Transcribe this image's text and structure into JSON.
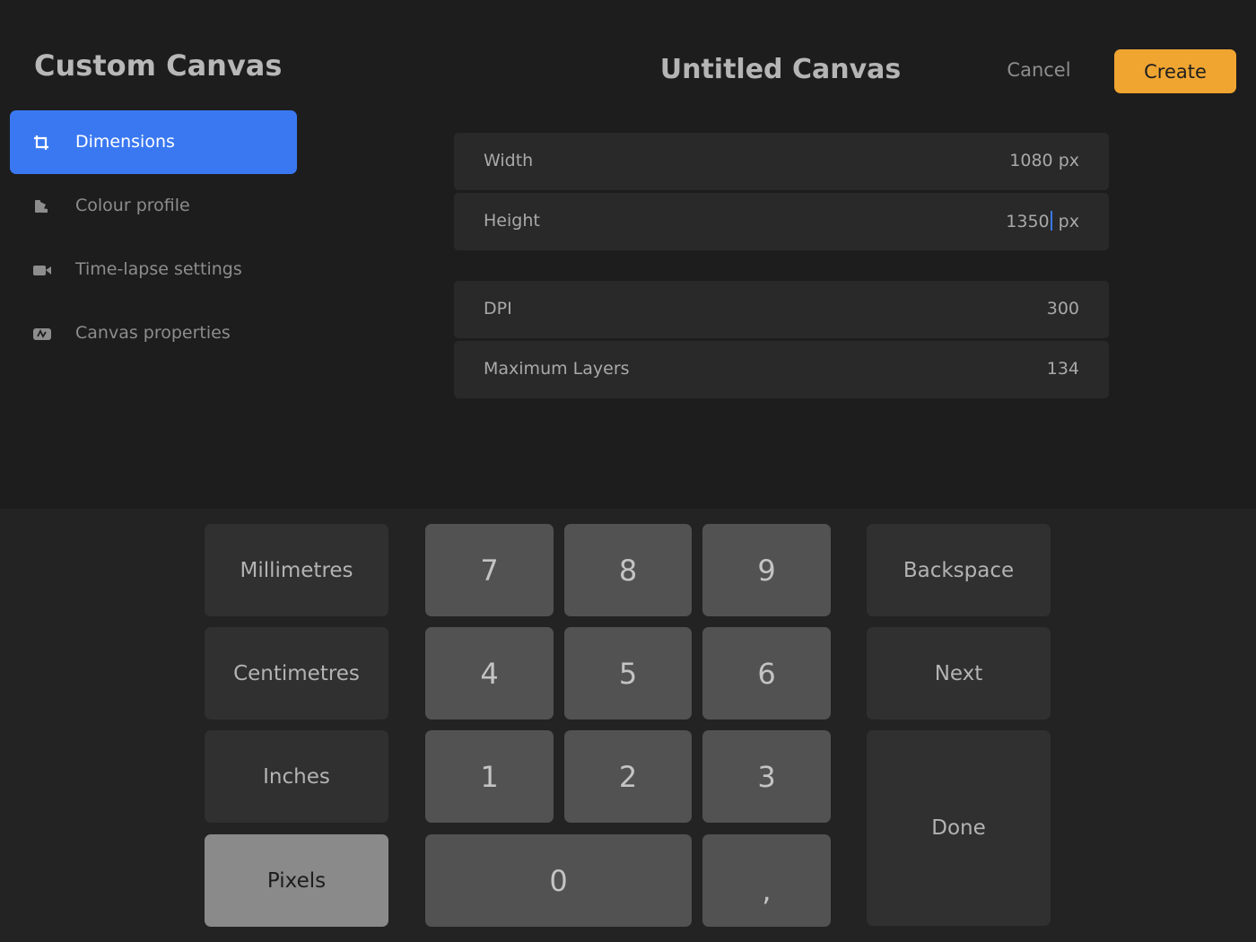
{
  "panel_title": "Custom Canvas",
  "sidebar": {
    "items": [
      {
        "label": "Dimensions",
        "icon": "crop-icon",
        "active": true
      },
      {
        "label": "Colour profile",
        "icon": "colour-swatch-icon",
        "active": false
      },
      {
        "label": "Time-lapse settings",
        "icon": "video-camera-icon",
        "active": false
      },
      {
        "label": "Canvas properties",
        "icon": "canvas-properties-icon",
        "active": false
      }
    ]
  },
  "header": {
    "title": "Untitled Canvas",
    "cancel_label": "Cancel",
    "create_label": "Create"
  },
  "fields": {
    "width": {
      "label": "Width",
      "value": "1080 px"
    },
    "height": {
      "label": "Height",
      "value_before_caret": "1350",
      "value_after_caret": " px"
    },
    "dpi": {
      "label": "DPI",
      "value": "300"
    },
    "max_layers": {
      "label": "Maximum Layers",
      "value": "134"
    }
  },
  "keypad": {
    "units": [
      "Millimetres",
      "Centimetres",
      "Inches",
      "Pixels"
    ],
    "selected_unit": "Pixels",
    "digits": [
      "7",
      "8",
      "9",
      "4",
      "5",
      "6",
      "1",
      "2",
      "3",
      "0",
      ","
    ],
    "backspace_label": "Backspace",
    "next_label": "Next",
    "done_label": "Done"
  },
  "colors": {
    "accent_blue": "#3a78f2",
    "create_orange": "#f0a531"
  }
}
